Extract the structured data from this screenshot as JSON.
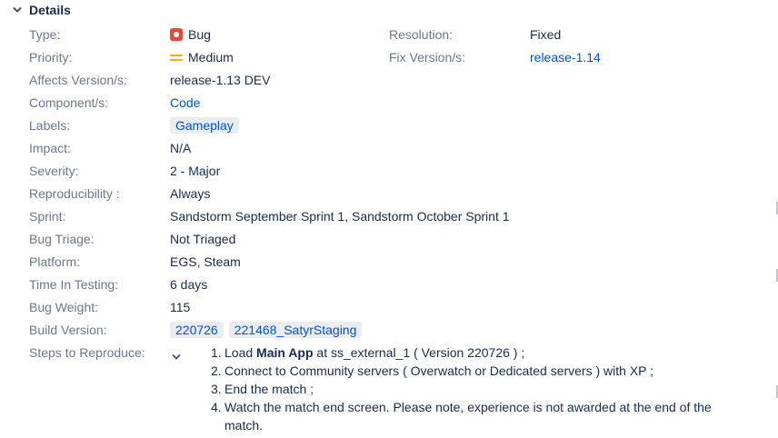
{
  "section": {
    "title": "Details"
  },
  "fields": {
    "type": {
      "label": "Type:",
      "value": "Bug"
    },
    "resolution": {
      "label": "Resolution:",
      "value": "Fixed"
    },
    "priority": {
      "label": "Priority:",
      "value": "Medium"
    },
    "fix_version": {
      "label": "Fix Version/s:",
      "value": "release-1.14"
    },
    "affects_version": {
      "label": "Affects Version/s:",
      "value": "release-1.13 DEV"
    },
    "component": {
      "label": "Component/s:",
      "value": "Code"
    },
    "labels": {
      "label": "Labels:",
      "items": [
        "Gameplay"
      ]
    },
    "impact": {
      "label": "Impact:",
      "value": "N/A"
    },
    "severity": {
      "label": "Severity:",
      "value": "2 - Major"
    },
    "reproducibility": {
      "label": "Reproducibility :",
      "value": "Always"
    },
    "sprint": {
      "label": "Sprint:",
      "value": "Sandstorm September Sprint 1, Sandstorm October Sprint 1"
    },
    "bug_triage": {
      "label": "Bug Triage:",
      "value": "Not Triaged"
    },
    "platform": {
      "label": "Platform:",
      "value": "EGS, Steam"
    },
    "time_in_testing": {
      "label": "Time In Testing:",
      "value": "6 days"
    },
    "bug_weight": {
      "label": "Bug Weight:",
      "value": "115"
    },
    "build_version": {
      "label": "Build Version:",
      "items": [
        "220726",
        "221468_SatyrStaging"
      ]
    },
    "steps": {
      "label": "Steps to Reproduce:",
      "items": [
        {
          "num": "1.",
          "pre": "Load ",
          "bold": "Main App",
          "post": " at ss_external_1 ( Version 220726 ) ;"
        },
        {
          "num": "2.",
          "text": "Connect to Community servers ( Overwatch or Dedicated servers ) with XP ;"
        },
        {
          "num": "3.",
          "text": "End the match ;"
        },
        {
          "num": "4.",
          "text": "Watch the match end screen. Please note, experience is not awarded at the end of the match."
        }
      ]
    }
  },
  "colors": {
    "label": "#6b778c",
    "text": "#172b4d",
    "link": "#0052cc",
    "bug": "#e5493a",
    "priority_medium": "#ffab00"
  }
}
